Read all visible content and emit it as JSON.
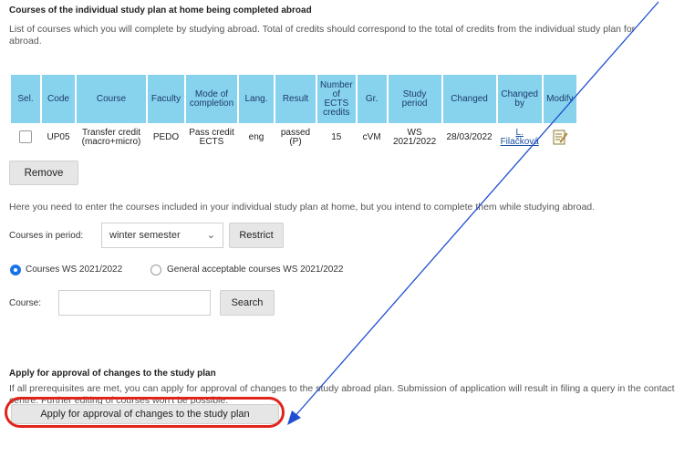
{
  "section1": {
    "title": "Courses of the individual study plan at home being completed abroad",
    "description": "List of courses which you will complete by studying abroad. Total of credits should correspond to the total of credits from the individual study plan for abroad."
  },
  "table": {
    "headers": [
      "Sel.",
      "Code",
      "Course",
      "Faculty",
      "Mode of completion",
      "Lang.",
      "Result",
      "Number of ECTS credits",
      "Gr.",
      "Study period",
      "Changed",
      "Changed by",
      "Modify"
    ],
    "row": {
      "code": "UP05",
      "course": "Transfer credit (macro+micro)",
      "faculty": "PEDO",
      "mode": "Pass credit ECTS",
      "lang": "eng",
      "result": "passed (P)",
      "credits": "15",
      "group": "cVM",
      "period": "WS 2021/2022",
      "changed": "28/03/2022",
      "changed_by": "L. Filačková",
      "modify_icon": "edit-icon"
    }
  },
  "remove_label": "Remove",
  "section2": {
    "info": "Here you need to enter the courses included in your individual study plan at home, but you intend to complete them while studying abroad.",
    "period_label": "Courses in period:",
    "period_value": "winter semester",
    "restrict_label": "Restrict",
    "radio1_label": "Courses WS 2021/2022",
    "radio2_label": "General acceptable courses WS 2021/2022",
    "course_label": "Course:",
    "course_value": "",
    "search_label": "Search"
  },
  "section3": {
    "title": "Apply for approval of changes to the study plan",
    "description": "If all prerequisites are met, you can apply for approval of changes to the study abroad plan. Submission of application will result in filing a query in the contact centre. Further editing of courses won't be possible.",
    "apply_label": "Apply for approval of changes to the study plan"
  },
  "colors": {
    "header_bg": "#87d3ee",
    "radio_selected": "#1a73e8",
    "highlight": "#e0241b",
    "arrow": "#1f4fd1"
  }
}
